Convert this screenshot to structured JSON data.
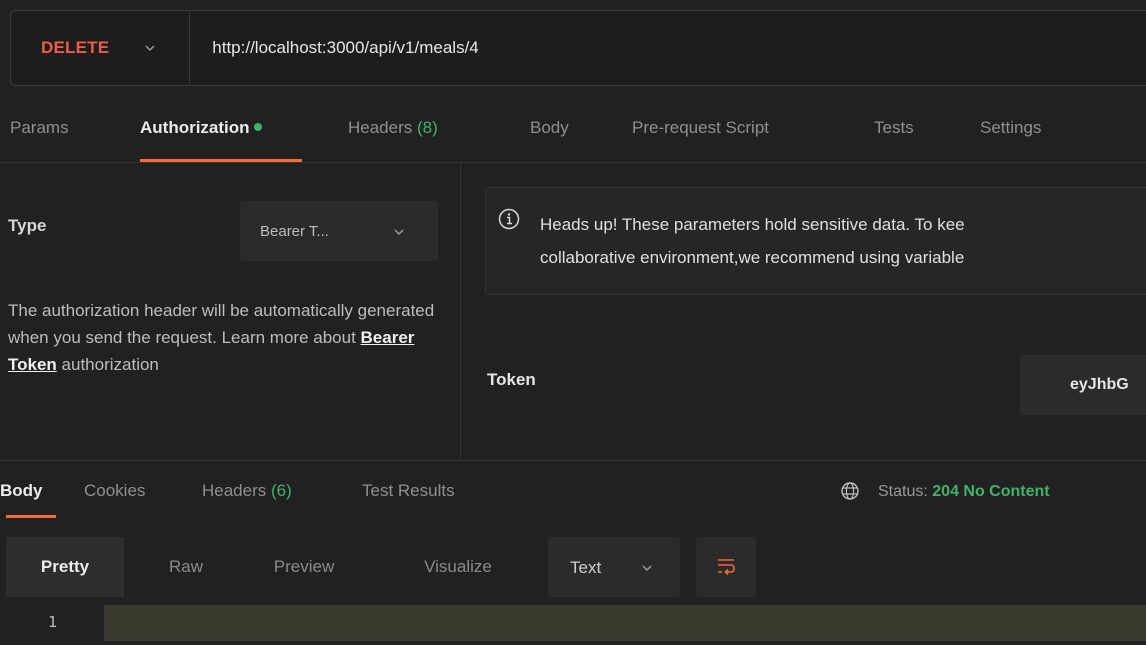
{
  "request": {
    "method": "DELETE",
    "url": "http://localhost:3000/api/v1/meals/4"
  },
  "request_tabs": {
    "params": "Params",
    "authorization": "Authorization",
    "headers": "Headers",
    "headers_count": "(8)",
    "body": "Body",
    "pre_request": "Pre-request Script",
    "tests": "Tests",
    "settings": "Settings"
  },
  "auth": {
    "type_label": "Type",
    "type_value": "Bearer T...",
    "description_1": "The authorization header will be automatically generated when you send the request. Learn more about ",
    "link": "Bearer Token",
    "description_2": " authorization",
    "heads_up_line1": "Heads up! These parameters hold sensitive data. To kee",
    "heads_up_line2": "collaborative environment,we recommend using variable",
    "token_label": "Token",
    "token_value": "eyJhbG"
  },
  "response_tabs": {
    "body": "Body",
    "cookies": "Cookies",
    "headers": "Headers",
    "headers_count": "(6)",
    "test_results": "Test Results"
  },
  "status": {
    "label": "Status:",
    "value": "204 No Content"
  },
  "view": {
    "pretty": "Pretty",
    "raw": "Raw",
    "preview": "Preview",
    "visualize": "Visualize",
    "format": "Text"
  },
  "editor": {
    "line_number": "1"
  },
  "colors": {
    "method": "#f05a46",
    "accent": "#f26b3a",
    "success": "#3fb26b"
  }
}
